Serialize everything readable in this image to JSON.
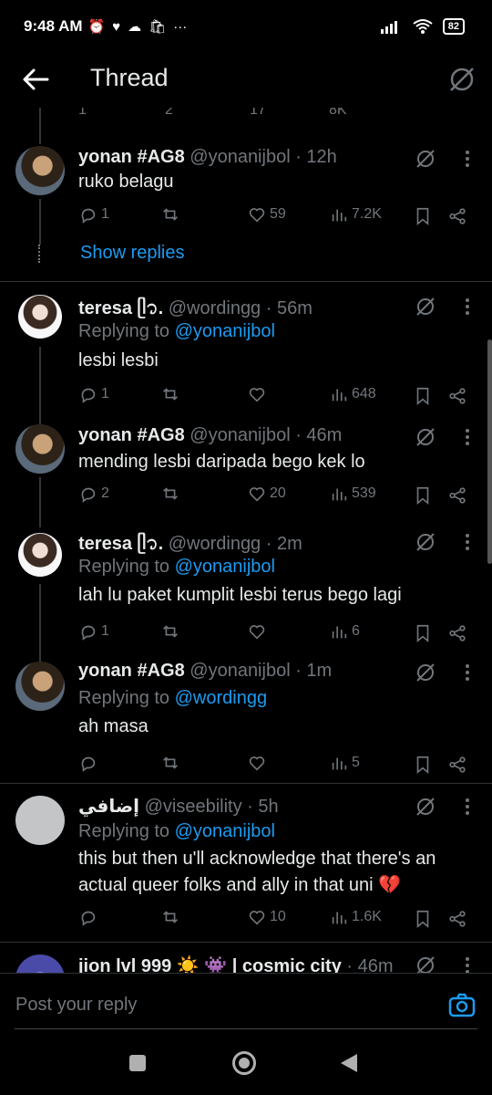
{
  "status": {
    "time": "9:48 AM",
    "battery": "82",
    "icons": [
      "alarm-icon",
      "heart-icon",
      "cloud-icon",
      "shopping-bag-icon",
      "more-dots"
    ]
  },
  "header": {
    "title": "Thread"
  },
  "partial_top": {
    "replies": "1",
    "reposts": "2",
    "likes": "17",
    "views": "8K"
  },
  "tweets": [
    {
      "name": "yonan #AG8",
      "handle": "@yonanijbol",
      "time": "· 12h",
      "text": "ruko belagu",
      "replies": "1",
      "reposts": "",
      "likes": "59",
      "views": "7.2K"
    },
    {
      "name": "teresa ᥫ᭡.",
      "handle": "@wordingg",
      "time": "· 56m",
      "replying_label": "Replying to",
      "replying_to": "@yonanijbol",
      "text": "lesbi lesbi",
      "replies": "1",
      "reposts": "",
      "likes": "",
      "views": "648"
    },
    {
      "name": "yonan #AG8",
      "handle": "@yonanijbol",
      "time": "· 46m",
      "text": "mending lesbi daripada bego kek lo",
      "replies": "2",
      "reposts": "",
      "likes": "20",
      "views": "539"
    },
    {
      "name": "teresa ᥫ᭡.",
      "handle": "@wordingg",
      "time": "· 2m",
      "replying_label": "Replying to",
      "replying_to": "@yonanijbol",
      "text": "lah lu paket kumplit lesbi terus bego lagi",
      "replies": "1",
      "reposts": "",
      "likes": "",
      "views": "6"
    },
    {
      "name": "yonan #AG8",
      "handle": "@yonanijbol",
      "time": "· 1m",
      "replying_label": "Replying to",
      "replying_to": "@wordingg",
      "text": "ah masa",
      "replies": "",
      "reposts": "",
      "likes": "",
      "views": "5"
    },
    {
      "name": "إضافي",
      "handle": "@viseebility",
      "time": "· 5h",
      "replying_label": "Replying to",
      "replying_to": "@yonanijbol",
      "text": "this but then u'll acknowledge that there's an actual queer folks and ally in that uni 💔",
      "replies": "",
      "reposts": "",
      "likes": "10",
      "views": "1.6K"
    },
    {
      "name": "jion lvl 999 ☀️ 👾 | cosmic city",
      "handle": "",
      "time": "· 46m"
    }
  ],
  "show_replies": "Show replies",
  "composer": {
    "placeholder": "Post your reply"
  },
  "colors": {
    "accent": "#1d9bf0",
    "muted": "#71767b",
    "text": "#e7e9ea",
    "background": "#000000"
  }
}
